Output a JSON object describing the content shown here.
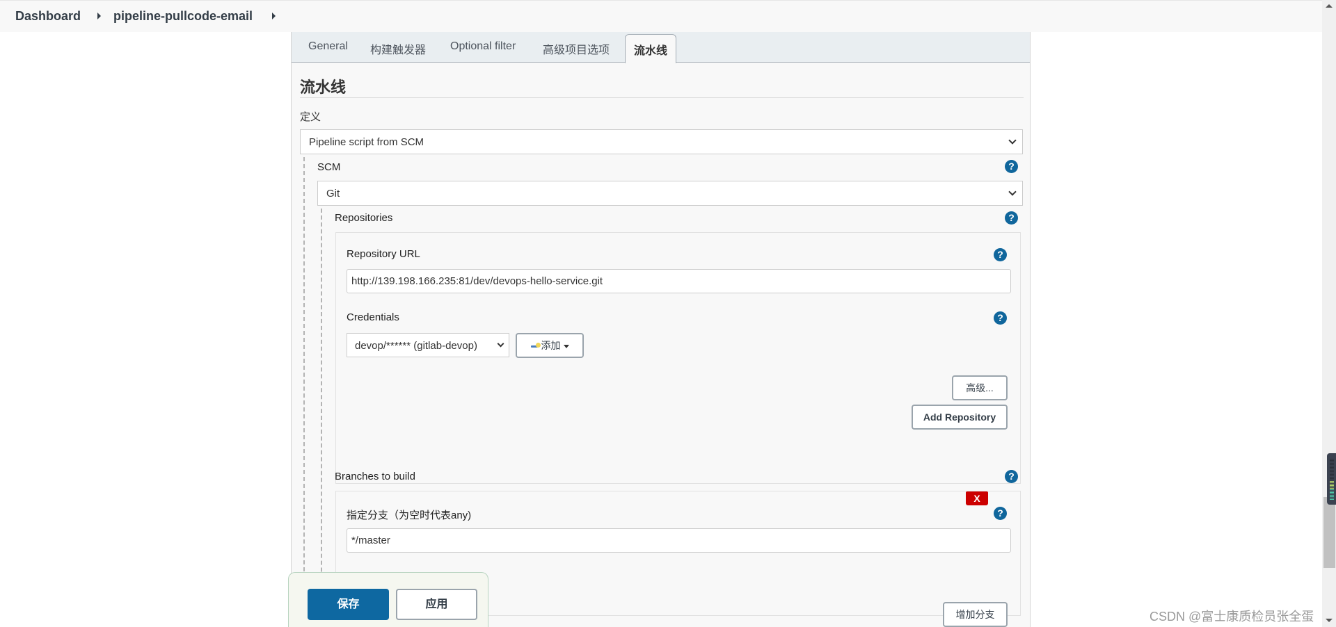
{
  "breadcrumb": {
    "items": [
      "Dashboard",
      "pipeline-pullcode-email"
    ]
  },
  "tabs": [
    {
      "label": "General",
      "active": false
    },
    {
      "label": "构建触发器",
      "active": false
    },
    {
      "label": "Optional filter",
      "active": false
    },
    {
      "label": "高级项目选项",
      "active": false
    },
    {
      "label": "流水线",
      "active": true
    }
  ],
  "pipeline": {
    "section_title": "流水线",
    "definition_label": "定义",
    "definition_value": "Pipeline script from SCM",
    "scm_label": "SCM",
    "scm_value": "Git",
    "repositories_label": "Repositories",
    "repository_url_label": "Repository URL",
    "repository_url_value": "http://139.198.166.235:81/dev/devops-hello-service.git",
    "credentials_label": "Credentials",
    "credentials_value": "devop/****** (gitlab-devop)",
    "add_credentials_label": "添加",
    "advanced_label": "高级...",
    "add_repository_label": "Add Repository",
    "branches_label": "Branches to build",
    "branch_specifier_label": "指定分支（为空时代表any)",
    "branch_specifier_value": "*/master",
    "delete_branch_label": "X",
    "add_branch_label": "增加分支",
    "help_glyph": "?"
  },
  "actions": {
    "save_label": "保存",
    "apply_label": "应用"
  },
  "watermark": "CSDN @富士康质检员张全蛋",
  "colors": {
    "primary": "#0e68a1",
    "help": "#10669c",
    "danger": "#cc0000"
  }
}
